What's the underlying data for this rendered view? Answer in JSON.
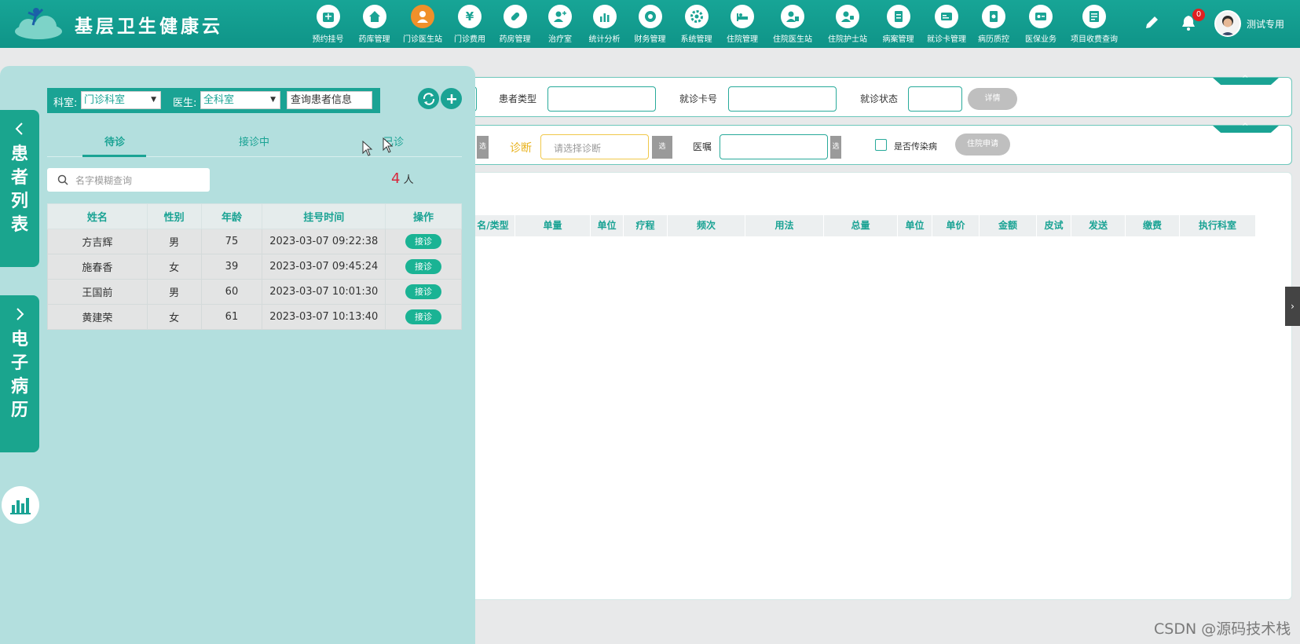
{
  "header": {
    "title": "基层卫生健康云",
    "nav": [
      {
        "label": "预约挂号",
        "icon": "calendar-icon"
      },
      {
        "label": "药库管理",
        "icon": "home-icon"
      },
      {
        "label": "门诊医生站",
        "icon": "doctor-icon",
        "active": true
      },
      {
        "label": "门诊费用",
        "icon": "yen-icon"
      },
      {
        "label": "药房管理",
        "icon": "pill-icon"
      },
      {
        "label": "治疗室",
        "icon": "treatment-icon"
      },
      {
        "label": "统计分析",
        "icon": "bar-chart-icon"
      },
      {
        "label": "财务管理",
        "icon": "finance-icon"
      },
      {
        "label": "系统管理",
        "icon": "settings-icon"
      },
      {
        "label": "住院管理",
        "icon": "bed-icon"
      },
      {
        "label": "住院医生站",
        "icon": "inpatient-doctor-icon"
      },
      {
        "label": "住院护士站",
        "icon": "nurse-icon"
      },
      {
        "label": "病案管理",
        "icon": "record-icon"
      },
      {
        "label": "就诊卡管理",
        "icon": "card-icon"
      },
      {
        "label": "病历质控",
        "icon": "quality-icon"
      },
      {
        "label": "医保业务",
        "icon": "insurance-icon"
      },
      {
        "label": "项目收费查询",
        "icon": "fee-query-icon"
      }
    ],
    "notification_count": "0",
    "username": "测试专用"
  },
  "form": {
    "patient_type_label": "患者类型",
    "card_no_label": "就诊卡号",
    "visit_status_label": "就诊状态",
    "detail_button": "详情",
    "select_label": "选",
    "diagnosis_label": "诊断",
    "diagnosis_placeholder": "请选择诊断",
    "advice_label": "医嘱",
    "infectious_label": "是否传染病",
    "hospitalize_button": "住院申请"
  },
  "grid_columns": [
    "名/类型",
    "单量",
    "单位",
    "疗程",
    "频次",
    "用法",
    "总量",
    "单位",
    "单价",
    "金额",
    "皮试",
    "发送",
    "缴费",
    "执行科室"
  ],
  "left_panel": {
    "patient_list_tab": "患者列表",
    "emr_tab": "电子病历",
    "dept_label": "科室:",
    "dept_value": "门诊科室",
    "doctor_label": "医生:",
    "doctor_value": "全科室",
    "query_input": "查询患者信息",
    "tabs": [
      "待诊",
      "接诊中",
      "已诊"
    ],
    "search_placeholder": "名字模糊查询",
    "count": "4",
    "count_unit": "人",
    "table_headers": [
      "姓名",
      "性别",
      "年龄",
      "挂号时间",
      "操作"
    ],
    "patients": [
      {
        "name": "方吉辉",
        "sex": "男",
        "age": "75",
        "time": "2023-03-07 09:22:38",
        "action": "接诊"
      },
      {
        "name": "施春香",
        "sex": "女",
        "age": "39",
        "time": "2023-03-07 09:45:24",
        "action": "接诊"
      },
      {
        "name": "王国前",
        "sex": "男",
        "age": "60",
        "time": "2023-03-07 10:01:30",
        "action": "接诊"
      },
      {
        "name": "黄建荣",
        "sex": "女",
        "age": "61",
        "time": "2023-03-07 10:13:40",
        "action": "接诊"
      }
    ]
  },
  "watermark": "CSDN @源码技术栈"
}
